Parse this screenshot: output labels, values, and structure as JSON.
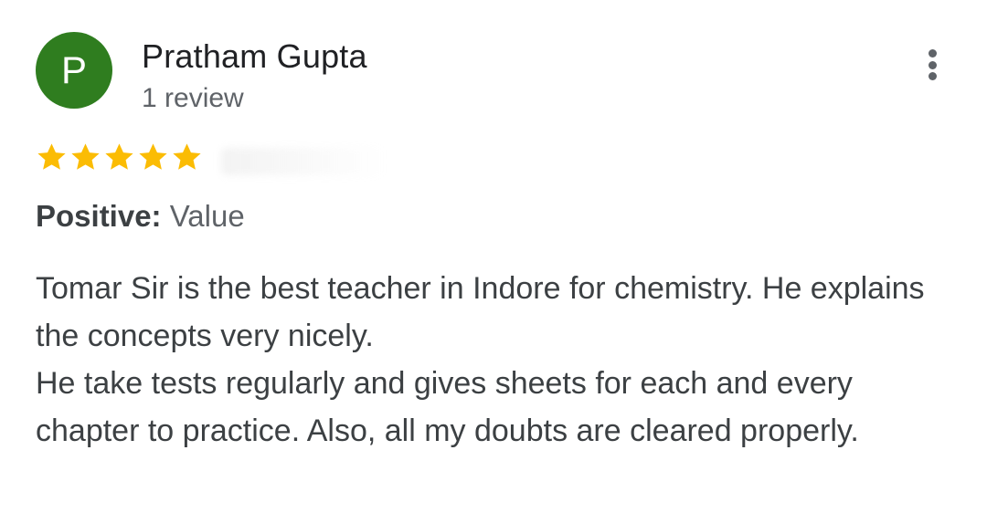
{
  "reviewer": {
    "initial": "P",
    "name": "Pratham Gupta",
    "review_count": "1 review",
    "avatar_color": "#2f7d1f"
  },
  "menu": {
    "icon": "more-vert-icon"
  },
  "rating": {
    "stars": 5,
    "max_stars": 5,
    "star_color": "#fbbc04"
  },
  "attribute": {
    "label": "Positive:",
    "value": "Value"
  },
  "review": {
    "paragraphs": [
      "Tomar Sir is the best teacher in Indore for chemistry. He explains the concepts very nicely.",
      "He take tests regularly and gives sheets for each and every chapter to practice. Also, all my doubts are cleared properly."
    ]
  }
}
